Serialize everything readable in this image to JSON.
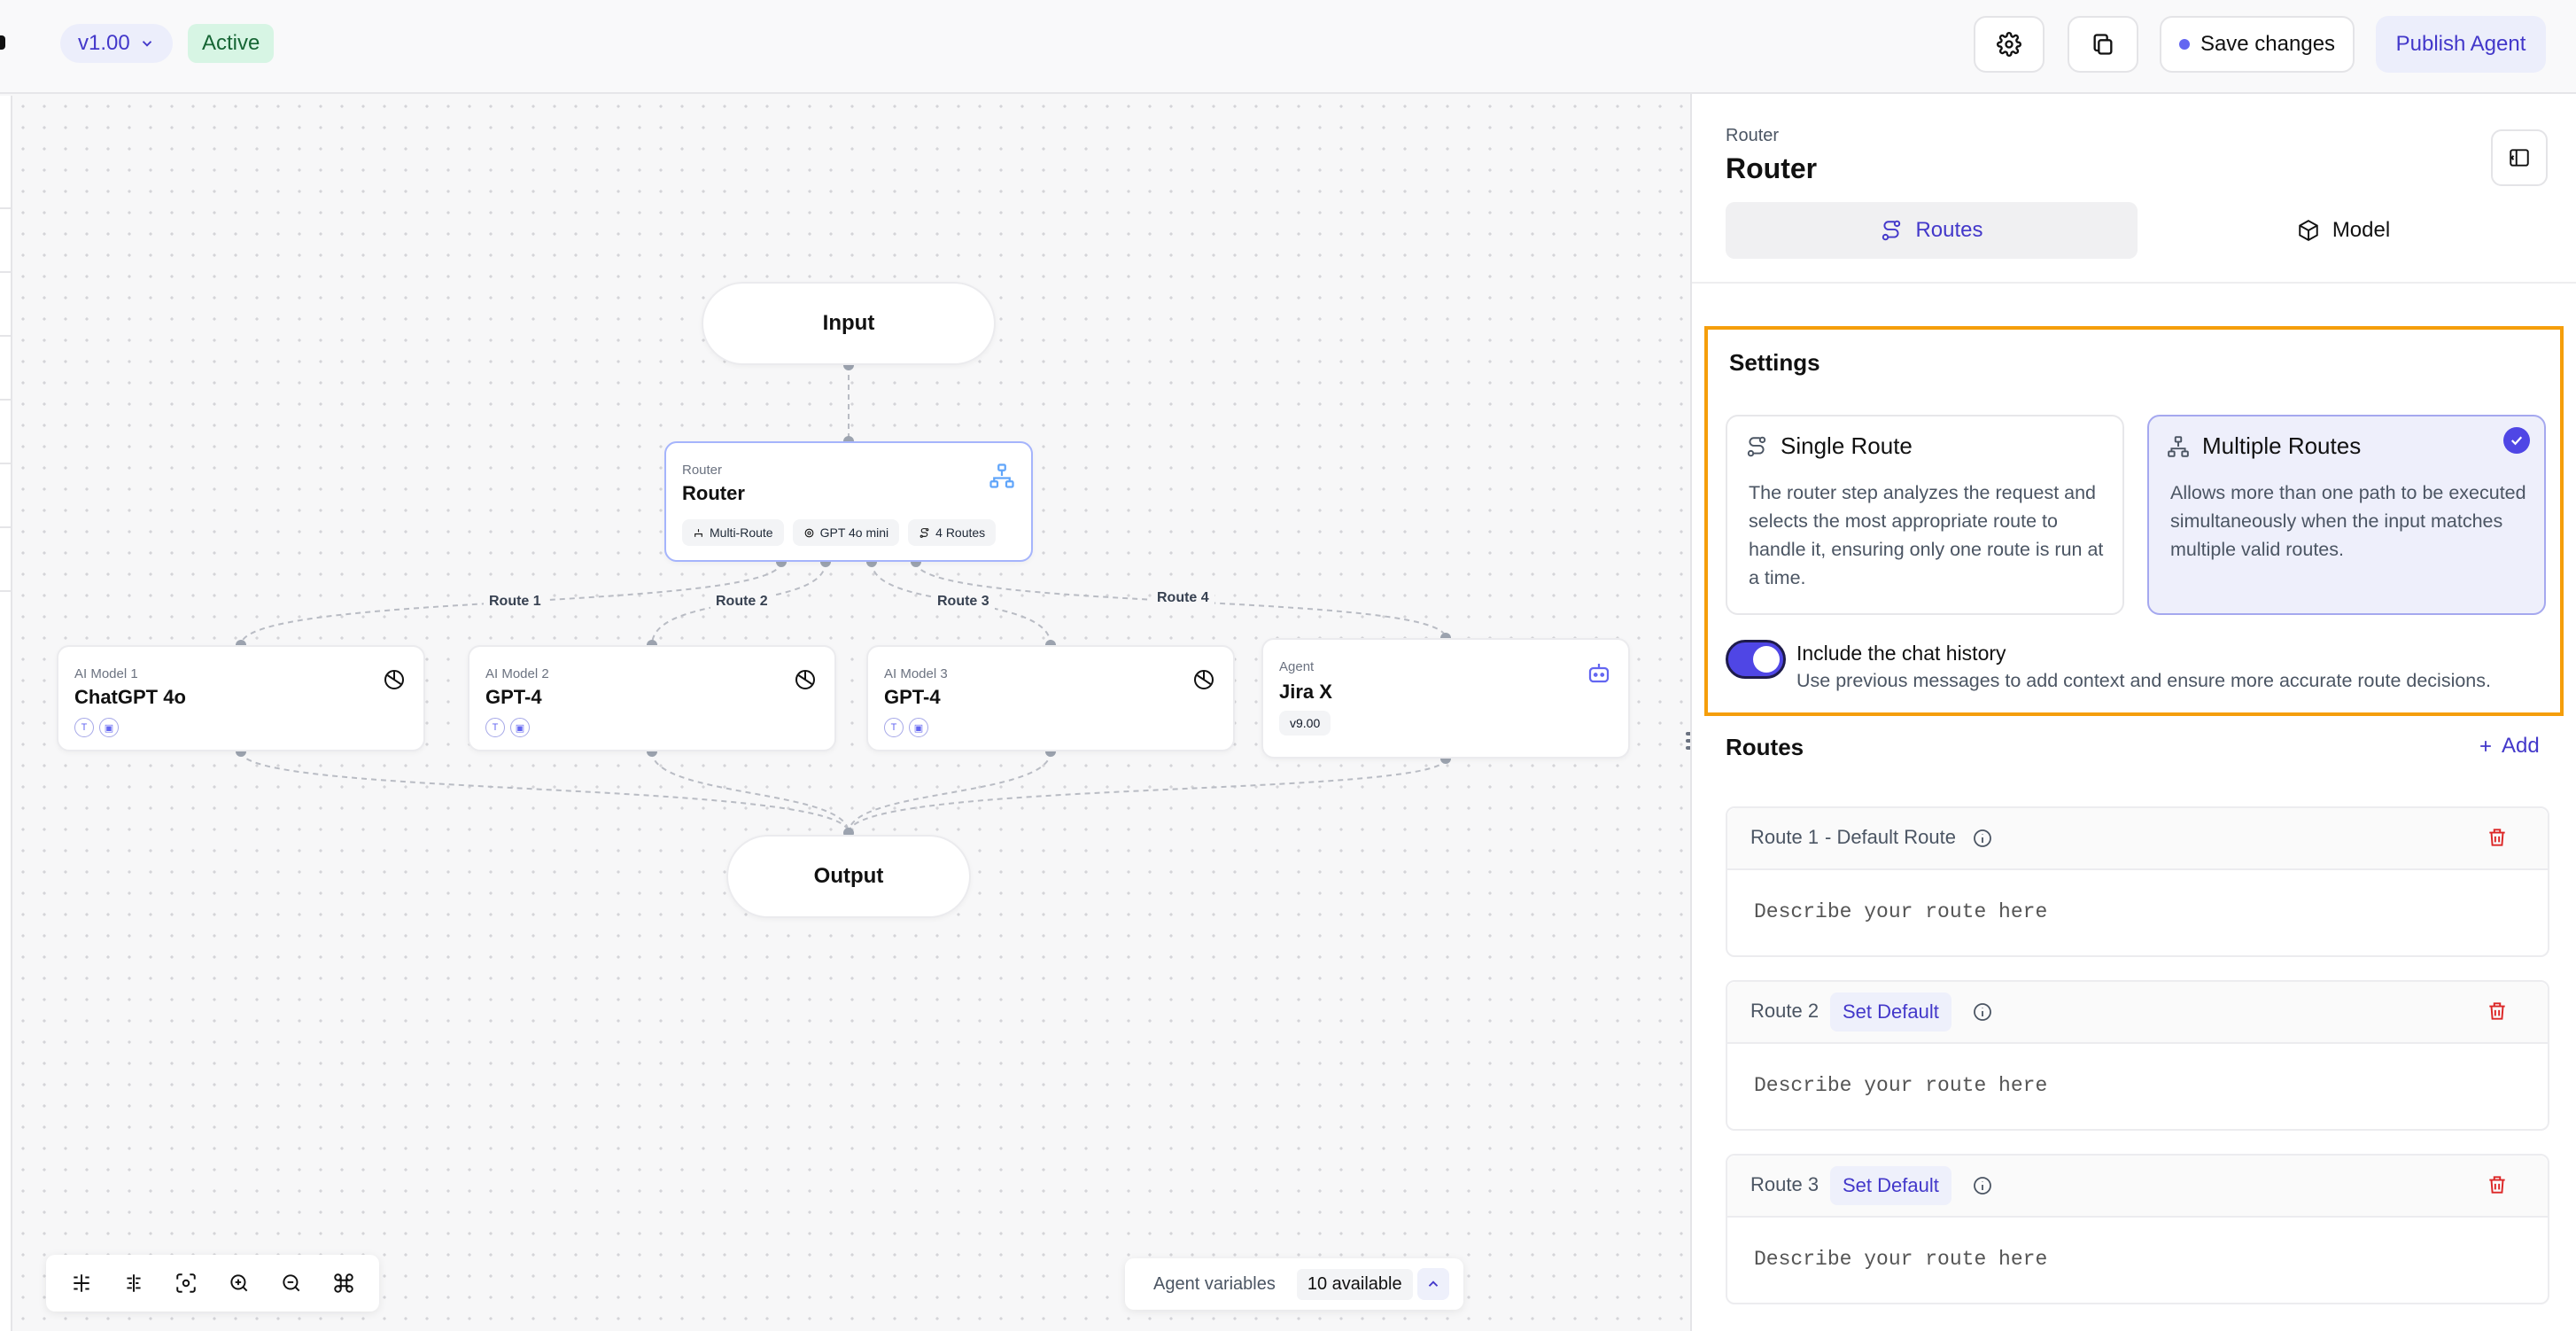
{
  "header": {
    "version": "v1.00",
    "status": "Active",
    "save_label": "Save changes",
    "publish_label": "Publish Agent"
  },
  "canvas": {
    "input_node": "Input",
    "output_node": "Output",
    "router": {
      "sub": "Router",
      "title": "Router",
      "chips": [
        "Multi-Route",
        "GPT 4o mini",
        "4 Routes"
      ]
    },
    "edge_labels": [
      "Route 1",
      "Route 2",
      "Route 3",
      "Route 4"
    ],
    "nodes": [
      {
        "sub": "AI Model 1",
        "title": "ChatGPT 4o",
        "icon": "openai-icon"
      },
      {
        "sub": "AI Model 2",
        "title": "GPT-4",
        "icon": "openai-icon"
      },
      {
        "sub": "AI Model 3",
        "title": "GPT-4",
        "icon": "openai-icon"
      },
      {
        "sub": "Agent",
        "title": "Jira X",
        "version": "v9.00",
        "icon": "robot-icon"
      }
    ],
    "agent_variables": {
      "label": "Agent variables",
      "count": "10 available"
    }
  },
  "panel": {
    "subtitle": "Router",
    "title": "Router",
    "tabs": [
      {
        "label": "Routes",
        "active": true
      },
      {
        "label": "Model",
        "active": false
      }
    ],
    "settings": {
      "title": "Settings",
      "options": [
        {
          "title": "Single Route",
          "desc": "The router step analyzes the request and selects the most appropriate route to handle it, ensuring only one route is run at a time.",
          "selected": false
        },
        {
          "title": "Multiple Routes",
          "desc": "Allows more than one path to be executed simultaneously when the input matches multiple valid routes.",
          "selected": true
        }
      ],
      "chat_history": {
        "title": "Include the chat history",
        "desc": "Use previous messages to add context and ensure more accurate route decisions.",
        "enabled": true
      }
    },
    "routes_title": "Routes",
    "add_label": "Add",
    "routes": [
      {
        "name": "Route 1",
        "default_label": "- Default Route",
        "placeholder": "Describe your route here"
      },
      {
        "name": "Route 2",
        "set_default_label": "Set Default",
        "placeholder": "Describe your route here"
      },
      {
        "name": "Route 3",
        "set_default_label": "Set Default",
        "placeholder": "Describe your route here"
      }
    ]
  },
  "colors": {
    "accent": "#4f46e5",
    "highlight": "#f59e0b",
    "active_bg": "#d7f5e4",
    "delete": "#dc2626"
  }
}
